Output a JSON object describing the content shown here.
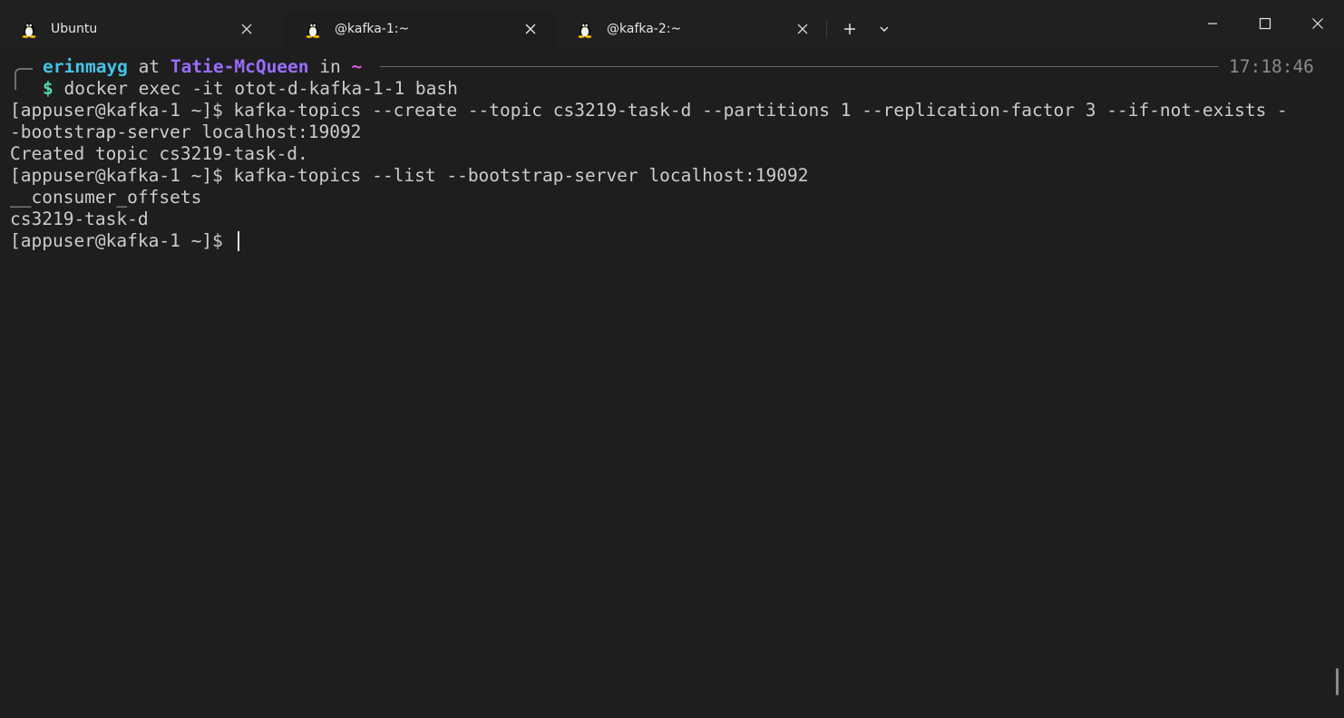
{
  "tabs": [
    {
      "title": "Ubuntu",
      "icon": "tux-icon"
    },
    {
      "title": "@kafka-1:~",
      "icon": "tux-icon",
      "active": true
    },
    {
      "title": "@kafka-2:~",
      "icon": "tux-icon"
    }
  ],
  "toolbar": {
    "new_tab_icon": "plus-icon",
    "dropdown_icon": "chevron-down-icon"
  },
  "window_controls": [
    "minimize-icon",
    "maximize-icon",
    "close-icon"
  ],
  "terminal": {
    "prompt": {
      "user": "erinmayg",
      "at": "at",
      "host": "Tatie-McQueen",
      "in": "in",
      "dir": "~",
      "time": "17:18:46",
      "dollar": "$",
      "command": "docker exec -it otot-d-kafka-1-1 bash"
    },
    "lines": [
      "[appuser@kafka-1 ~]$ kafka-topics --create --topic cs3219-task-d --partitions 1 --replication-factor 3 --if-not-exists -",
      "-bootstrap-server localhost:19092",
      "Created topic cs3219-task-d.",
      "[appuser@kafka-1 ~]$ kafka-topics --list --bootstrap-server localhost:19092",
      "__consumer_offsets",
      "cs3219-task-d",
      "[appuser@kafka-1 ~]$ "
    ]
  },
  "colors": {
    "user": "#3fc5e6",
    "host": "#9a6cff",
    "dir": "#e05be0",
    "dollar": "#4fd9b3",
    "background": "#1e1e1e"
  }
}
